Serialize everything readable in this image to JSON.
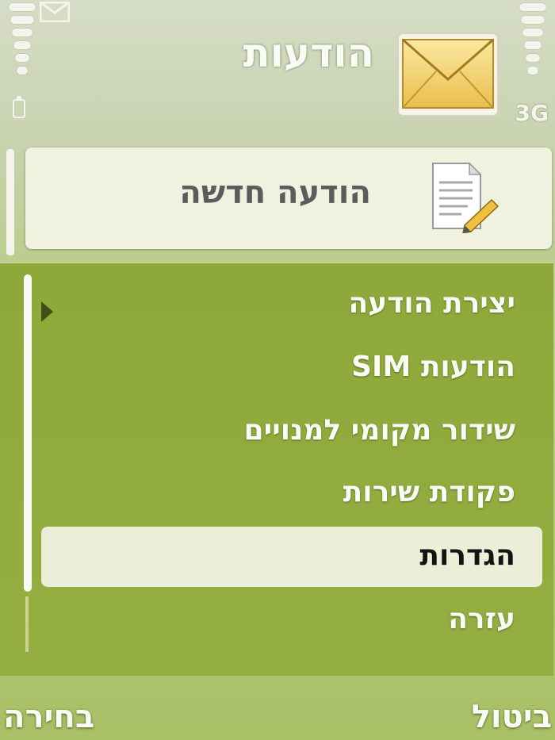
{
  "status_bar": {
    "signal_level": 6,
    "battery_level": 0,
    "network_label": "3G",
    "indicator_icon": "envelope-icon"
  },
  "header": {
    "title": "הודעות",
    "app_icon": "envelope-icon"
  },
  "top_item": {
    "label": "הודעה חדשה",
    "icon": "document-pencil-icon"
  },
  "menu": {
    "items": [
      {
        "label": "יצירת הודעה",
        "has_submenu": true
      },
      {
        "label": "הודעות SIM"
      },
      {
        "label": "שידור מקומי למנויים"
      },
      {
        "label": "פקודת שירות"
      },
      {
        "label": "הגדרות",
        "selected": true
      },
      {
        "label": "עזרה"
      }
    ]
  },
  "softkeys": {
    "left": "בחירה",
    "right": "ביטול"
  },
  "colors": {
    "menu_bg": "#95ae42",
    "selection_bg": "#ecefd8",
    "text_light": "#fbfbf5"
  }
}
